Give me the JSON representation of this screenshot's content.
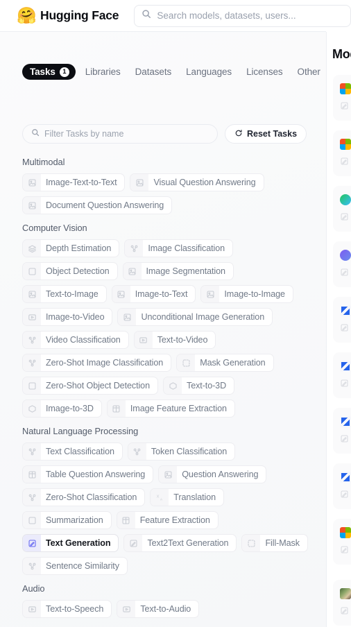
{
  "header": {
    "logo_icon": "hugging-face-emoji",
    "logo_glyph": "🤗",
    "brand": "Hugging Face",
    "search_placeholder": "Search models, datasets, users...",
    "search_value": "",
    "search_icon": "search-icon"
  },
  "tabs": {
    "items": [
      {
        "label": "Tasks",
        "badge": "1",
        "active": true
      },
      {
        "label": "Libraries",
        "badge": "",
        "active": false
      },
      {
        "label": "Datasets",
        "badge": "",
        "active": false
      },
      {
        "label": "Languages",
        "badge": "",
        "active": false
      },
      {
        "label": "Licenses",
        "badge": "",
        "active": false
      },
      {
        "label": "Other",
        "badge": "",
        "active": false
      }
    ]
  },
  "filter": {
    "placeholder": "Filter Tasks by name",
    "value": "",
    "search_icon": "search-icon",
    "reset_label": "Reset Tasks",
    "reset_icon": "reset-circular-arrow-icon"
  },
  "sections": [
    {
      "title": "Multimodal",
      "chips": [
        {
          "label": "Image-Text-to-Text",
          "icon": "image-text-to-text-icon",
          "selected": false
        },
        {
          "label": "Visual Question Answering",
          "icon": "visual-question-answering-icon",
          "selected": false
        },
        {
          "label": "Document Question Answering",
          "icon": "document-question-answering-icon",
          "selected": false
        }
      ]
    },
    {
      "title": "Computer Vision",
      "chips": [
        {
          "label": "Depth Estimation",
          "icon": "depth-estimation-icon",
          "selected": false
        },
        {
          "label": "Image Classification",
          "icon": "image-classification-icon",
          "selected": false
        },
        {
          "label": "Object Detection",
          "icon": "object-detection-icon",
          "selected": false
        },
        {
          "label": "Image Segmentation",
          "icon": "image-segmentation-icon",
          "selected": false
        },
        {
          "label": "Text-to-Image",
          "icon": "text-to-image-icon",
          "selected": false
        },
        {
          "label": "Image-to-Text",
          "icon": "image-to-text-icon",
          "selected": false
        },
        {
          "label": "Image-to-Image",
          "icon": "image-to-image-icon",
          "selected": false
        },
        {
          "label": "Image-to-Video",
          "icon": "image-to-video-icon",
          "selected": false
        },
        {
          "label": "Unconditional Image Generation",
          "icon": "unconditional-image-generation-icon",
          "selected": false
        },
        {
          "label": "Video Classification",
          "icon": "video-classification-icon",
          "selected": false
        },
        {
          "label": "Text-to-Video",
          "icon": "text-to-video-icon",
          "selected": false
        },
        {
          "label": "Zero-Shot Image Classification",
          "icon": "zero-shot-image-classification-icon",
          "selected": false
        },
        {
          "label": "Mask Generation",
          "icon": "mask-generation-icon",
          "selected": false
        },
        {
          "label": "Zero-Shot Object Detection",
          "icon": "zero-shot-object-detection-icon",
          "selected": false
        },
        {
          "label": "Text-to-3D",
          "icon": "text-to-3d-icon",
          "selected": false
        },
        {
          "label": "Image-to-3D",
          "icon": "image-to-3d-icon",
          "selected": false
        },
        {
          "label": "Image Feature Extraction",
          "icon": "image-feature-extraction-icon",
          "selected": false
        }
      ]
    },
    {
      "title": "Natural Language Processing",
      "chips": [
        {
          "label": "Text Classification",
          "icon": "text-classification-icon",
          "selected": false
        },
        {
          "label": "Token Classification",
          "icon": "token-classification-icon",
          "selected": false
        },
        {
          "label": "Table Question Answering",
          "icon": "table-question-answering-icon",
          "selected": false
        },
        {
          "label": "Question Answering",
          "icon": "question-answering-icon",
          "selected": false
        },
        {
          "label": "Zero-Shot Classification",
          "icon": "zero-shot-classification-icon",
          "selected": false
        },
        {
          "label": "Translation",
          "icon": "translation-icon",
          "selected": false
        },
        {
          "label": "Summarization",
          "icon": "summarization-icon",
          "selected": false
        },
        {
          "label": "Feature Extraction",
          "icon": "feature-extraction-icon",
          "selected": false
        },
        {
          "label": "Text Generation",
          "icon": "text-generation-icon",
          "selected": true
        },
        {
          "label": "Text2Text Generation",
          "icon": "text2text-generation-icon",
          "selected": false
        },
        {
          "label": "Fill-Mask",
          "icon": "fill-mask-icon",
          "selected": false
        },
        {
          "label": "Sentence Similarity",
          "icon": "sentence-similarity-icon",
          "selected": false
        }
      ]
    },
    {
      "title": "Audio",
      "chips": [
        {
          "label": "Text-to-Speech",
          "icon": "text-to-speech-icon",
          "selected": false
        },
        {
          "label": "Text-to-Audio",
          "icon": "text-to-audio-icon",
          "selected": false
        }
      ]
    }
  ],
  "right_panel": {
    "title": "Models",
    "cards": [
      {
        "thumb": "microsoft-logo-swatch",
        "style": "sw-ms"
      },
      {
        "thumb": "microsoft-logo-swatch",
        "style": "sw-ms"
      },
      {
        "thumb": "green-gradient-avatar",
        "style": "sw-green"
      },
      {
        "thumb": "purple-gradient-avatar",
        "style": "sw-purple"
      },
      {
        "thumb": "blue-mark-avatar",
        "style": "sw-blue"
      },
      {
        "thumb": "blue-mark-avatar",
        "style": "sw-blue"
      },
      {
        "thumb": "blue-mark-avatar",
        "style": "sw-blue"
      },
      {
        "thumb": "blue-mark-avatar",
        "style": "sw-blue"
      },
      {
        "thumb": "microsoft-logo-swatch",
        "style": "sw-ms"
      },
      {
        "thumb": "photo-avatar",
        "style": "sw-photo"
      }
    ]
  },
  "colors": {
    "brand_text": "#0b0d12",
    "accent_indigo": "#6366f1",
    "selected_chip_icon_bg": "#ebebfb",
    "chip_label": "#717a88",
    "section_title": "#525a69",
    "pane_bg": "#f8f9fa",
    "active_tab_bg": "#0b0d12"
  }
}
